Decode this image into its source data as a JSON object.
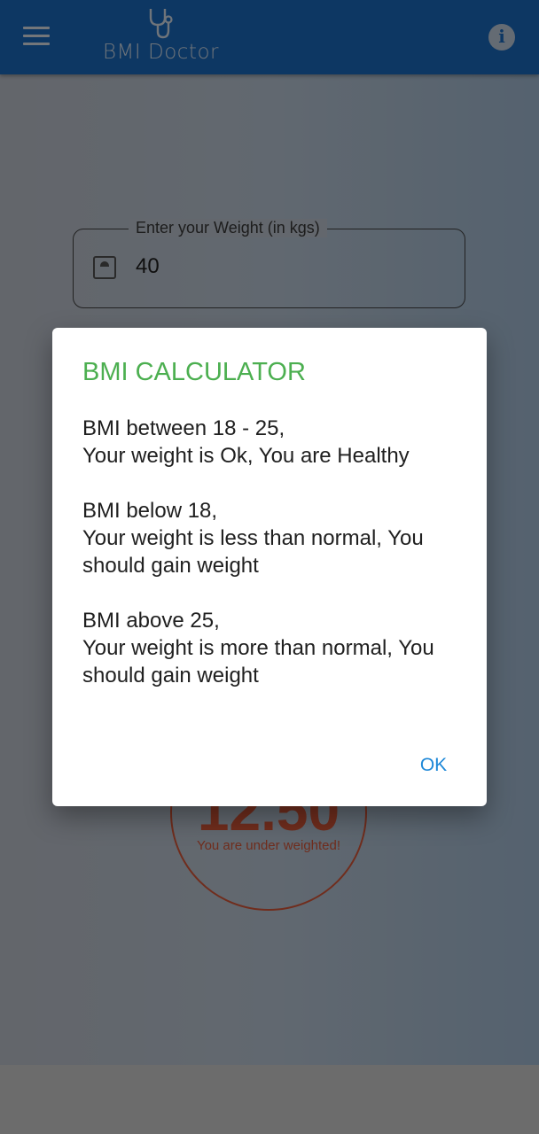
{
  "app": {
    "title": "BMI Doctor",
    "colors": {
      "appbar": "#1b6fc7",
      "accent": "#4caf50",
      "result": "#e05a3a",
      "button": "#1e88d8"
    }
  },
  "weight_field": {
    "label": "Enter your Weight (in kgs)",
    "value": "40",
    "icon": "scale-icon"
  },
  "result": {
    "value": "12.50",
    "status": "You are under weighted!"
  },
  "dialog": {
    "title": "BMI CALCULATOR",
    "paragraphs": [
      "BMI between 18 - 25,\nYour weight is Ok, You are Healthy",
      "BMI below 18,\nYour weight is less than normal, You should gain weight",
      "BMI above 25,\nYour weight is more than normal, You should gain weight"
    ],
    "ok_label": "OK"
  }
}
